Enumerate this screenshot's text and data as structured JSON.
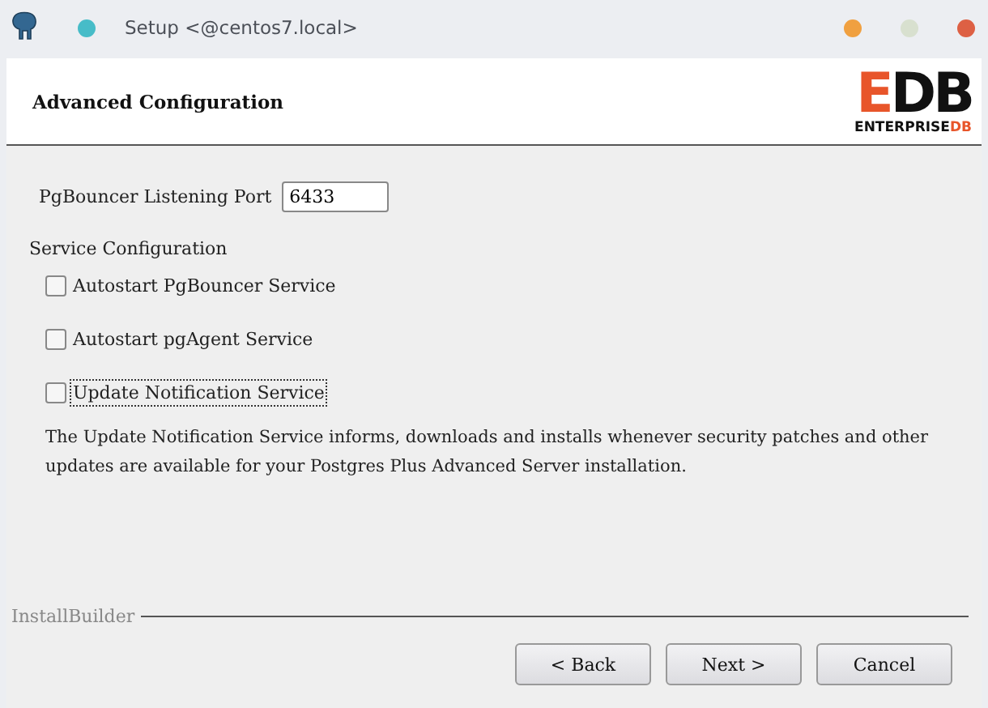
{
  "window": {
    "title": "Setup <@centos7.local>"
  },
  "header": {
    "title": "Advanced Configuration",
    "logo": {
      "mark": "EDB",
      "word": "ENTERPRISE",
      "word_accent": "DB"
    }
  },
  "port": {
    "label": "PgBouncer Listening Port",
    "value": "6433"
  },
  "section": "Service Configuration",
  "options": [
    {
      "label": "Autostart PgBouncer Service",
      "checked": false,
      "focused": false
    },
    {
      "label": "Autostart pgAgent Service",
      "checked": false,
      "focused": false
    },
    {
      "label": "Update Notification Service",
      "checked": false,
      "focused": true
    }
  ],
  "description": "The Update Notification Service informs, downloads and installs whenever security patches and other updates are available for your Postgres Plus Advanced Server installation.",
  "footer": {
    "brand": "InstallBuilder",
    "buttons": [
      "< Back",
      "Next >",
      "Cancel"
    ]
  }
}
